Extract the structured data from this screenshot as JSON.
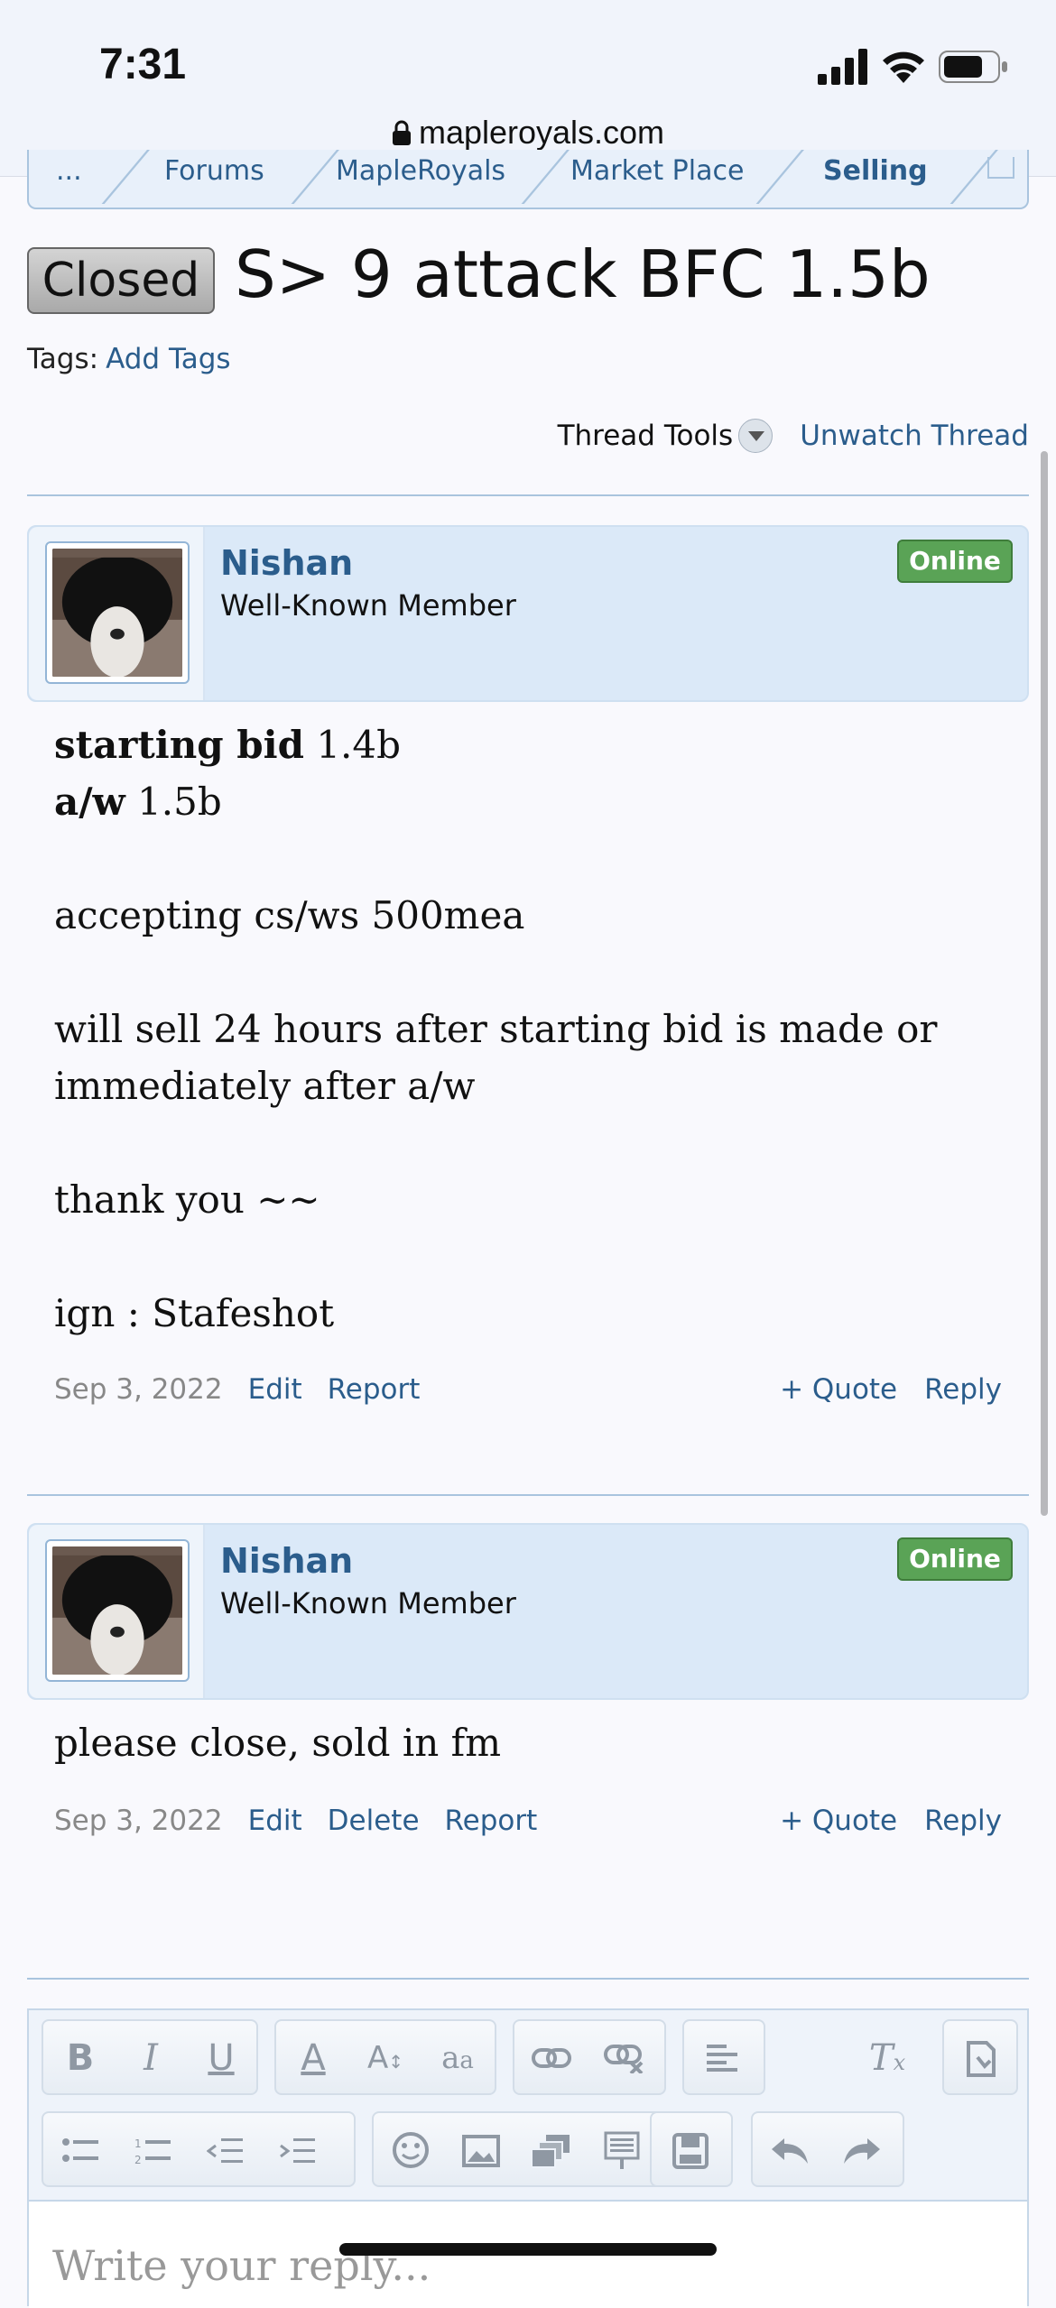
{
  "status": {
    "time": "7:31"
  },
  "browser": {
    "url": "mapleroyals.com"
  },
  "breadcrumb": [
    "...",
    "Forums",
    "MapleRoyals",
    "Market Place",
    "Selling"
  ],
  "thread": {
    "prefix": "Closed",
    "title": "S> 9 attack BFC 1.5b",
    "tags_label": "Tags:",
    "add_tags": "Add Tags",
    "thread_tools": "Thread Tools",
    "unwatch": "Unwatch Thread"
  },
  "posts": [
    {
      "username": "Nishan",
      "user_title": "Well-Known Member",
      "status_badge": "Online",
      "lines": {
        "l1_bold": "starting bid",
        "l1_rest": " 1.4b",
        "l2_bold": "a/w",
        "l2_rest": " 1.5b",
        "l3": "accepting cs/ws 500mea",
        "l4": "will sell 24 hours after starting bid is made or immediately after a/w",
        "l5": "thank you ~~",
        "l6": "ign : Stafeshot"
      },
      "date": "Sep 3, 2022",
      "actions": [
        "Edit",
        "Report"
      ],
      "quote": "+ Quote",
      "reply": "Reply"
    },
    {
      "username": "Nishan",
      "user_title": "Well-Known Member",
      "status_badge": "Online",
      "text": "please close, sold in fm",
      "date": "Sep 3, 2022",
      "actions": [
        "Edit",
        "Delete",
        "Report"
      ],
      "quote": "+ Quote",
      "reply": "Reply"
    }
  ],
  "editor": {
    "placeholder": "Write your reply...",
    "toolbar_row1": [
      "bold-icon",
      "italic-icon",
      "underline-icon",
      "text-color-icon",
      "font-size-icon",
      "font-family-icon",
      "link-icon",
      "unlink-icon",
      "align-icon",
      "remove-format-icon",
      "toggle-bbcode-icon"
    ],
    "toolbar_row2": [
      "bullet-list-icon",
      "numbered-list-icon",
      "outdent-icon",
      "indent-icon",
      "smilie-icon",
      "image-icon",
      "media-icon",
      "insert-icon",
      "save-draft-icon",
      "undo-icon",
      "redo-icon"
    ]
  }
}
